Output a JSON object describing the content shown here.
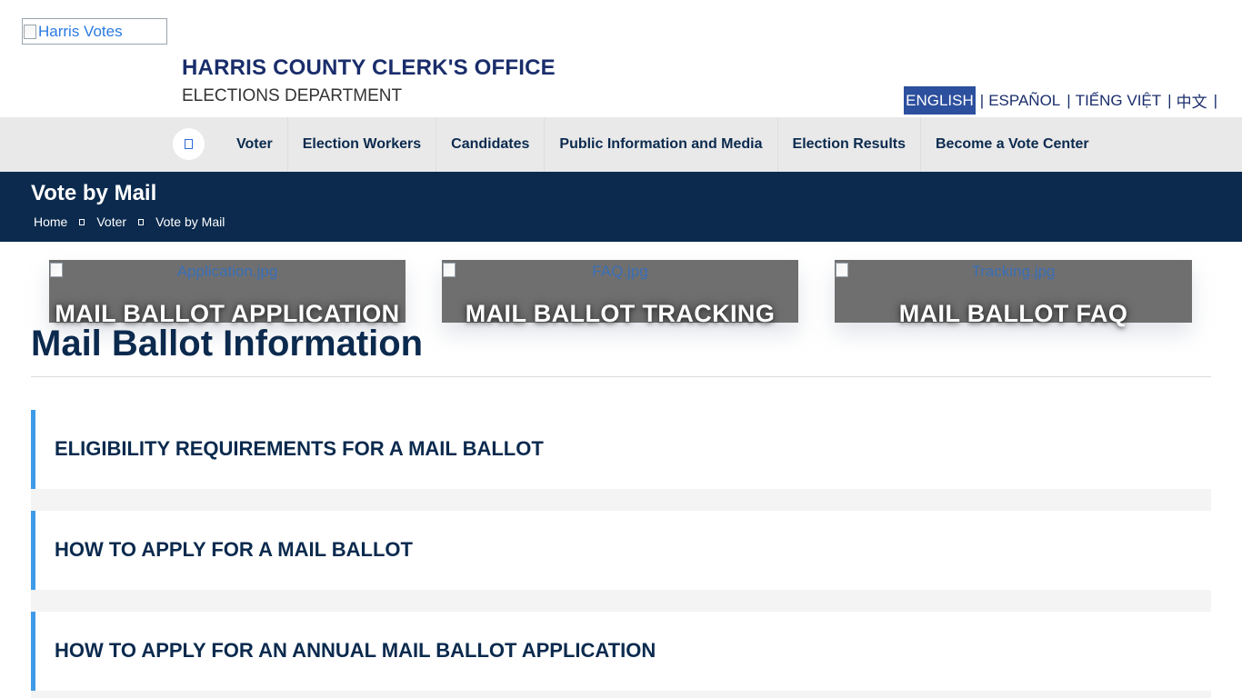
{
  "header": {
    "logo_alt": "Harris Votes",
    "org_title": "HARRIS COUNTY CLERK'S OFFICE",
    "org_subtitle": "ELECTIONS DEPARTMENT"
  },
  "languages": [
    {
      "label": "ENGLISH",
      "active": true
    },
    {
      "label": "ESPAÑOL",
      "active": false
    },
    {
      "label": "TIẾNG VIỆT",
      "active": false
    },
    {
      "label": "中文",
      "active": false
    }
  ],
  "language_separator": "|",
  "nav": {
    "home_icon": "home-icon",
    "items": [
      "Voter",
      "Election Workers",
      "Candidates",
      "Public Information and Media",
      "Election Results",
      "Become a Vote Center"
    ]
  },
  "banner": {
    "title": "Vote by Mail",
    "breadcrumb": [
      "Home",
      "Voter",
      "Vote by Mail"
    ]
  },
  "cards": [
    {
      "image_alt": "Application.jpg",
      "label": "MAIL BALLOT APPLICATION"
    },
    {
      "image_alt": "FAQ.jpg",
      "label": "MAIL BALLOT TRACKING"
    },
    {
      "image_alt": "Tracking.jpg",
      "label": "MAIL BALLOT FAQ"
    }
  ],
  "section": {
    "title": "Mail Ballot Information"
  },
  "accordions": [
    "ELIGIBILITY REQUIREMENTS FOR A MAIL BALLOT",
    "HOW TO APPLY FOR A MAIL BALLOT",
    "HOW TO APPLY FOR AN ANNUAL MAIL BALLOT APPLICATION"
  ],
  "colors": {
    "navy": "#0b2a4e",
    "accent_blue": "#3f9be8",
    "language_active_bg": "#2c4f9e",
    "nav_bg": "#e9e9e9",
    "card_bg": "#6f6f6f"
  }
}
